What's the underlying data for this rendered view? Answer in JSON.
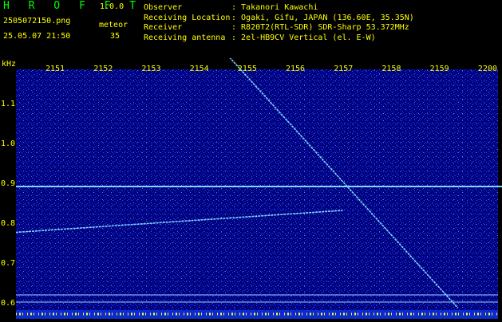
{
  "header": {
    "app_title": "H R O F F T",
    "app_version": "1.0.0",
    "file_name": "2505072150.png",
    "event_label": "meteor",
    "timestamp": "25.05.07 21:50",
    "event_count": "35",
    "info": [
      {
        "key": "Observer",
        "value": ": Takanori Kawachi"
      },
      {
        "key": "Receiving Location",
        "value": ": Ogaki, Gifu, JAPAN (136.60E, 35.35N)"
      },
      {
        "key": "Receiver",
        "value": ": R820T2(RTL-SDR) SDR-Sharp 53.372MHz"
      },
      {
        "key": "Receiving antenna",
        "value": ": 2el-HB9CV Vertical (el. E-W)"
      }
    ]
  },
  "colors": {
    "label": "#ffff00",
    "title": "#00ff00",
    "background": "#00007a",
    "trace": "#7fd8ff"
  },
  "chart_data": {
    "type": "spectrogram",
    "y_unit": "kHz",
    "x_ticks": [
      "2151",
      "2152",
      "2153",
      "2154",
      "2155",
      "2156",
      "2157",
      "2158",
      "2159",
      "2200"
    ],
    "y_ticks": [
      "1.1",
      "1.0",
      "0.9",
      "0.8",
      "0.7",
      "0.6"
    ],
    "traces": [
      {
        "name": "carrier",
        "points": [
          [
            2150.0,
            0.89
          ],
          [
            2200.0,
            0.89
          ]
        ]
      },
      {
        "name": "meteor-1",
        "points": [
          [
            2150.0,
            0.775
          ],
          [
            2156.8,
            0.83
          ]
        ]
      },
      {
        "name": "meteor-2",
        "points": [
          [
            2154.4,
            1.22
          ],
          [
            2159.2,
            0.585
          ]
        ]
      }
    ]
  }
}
